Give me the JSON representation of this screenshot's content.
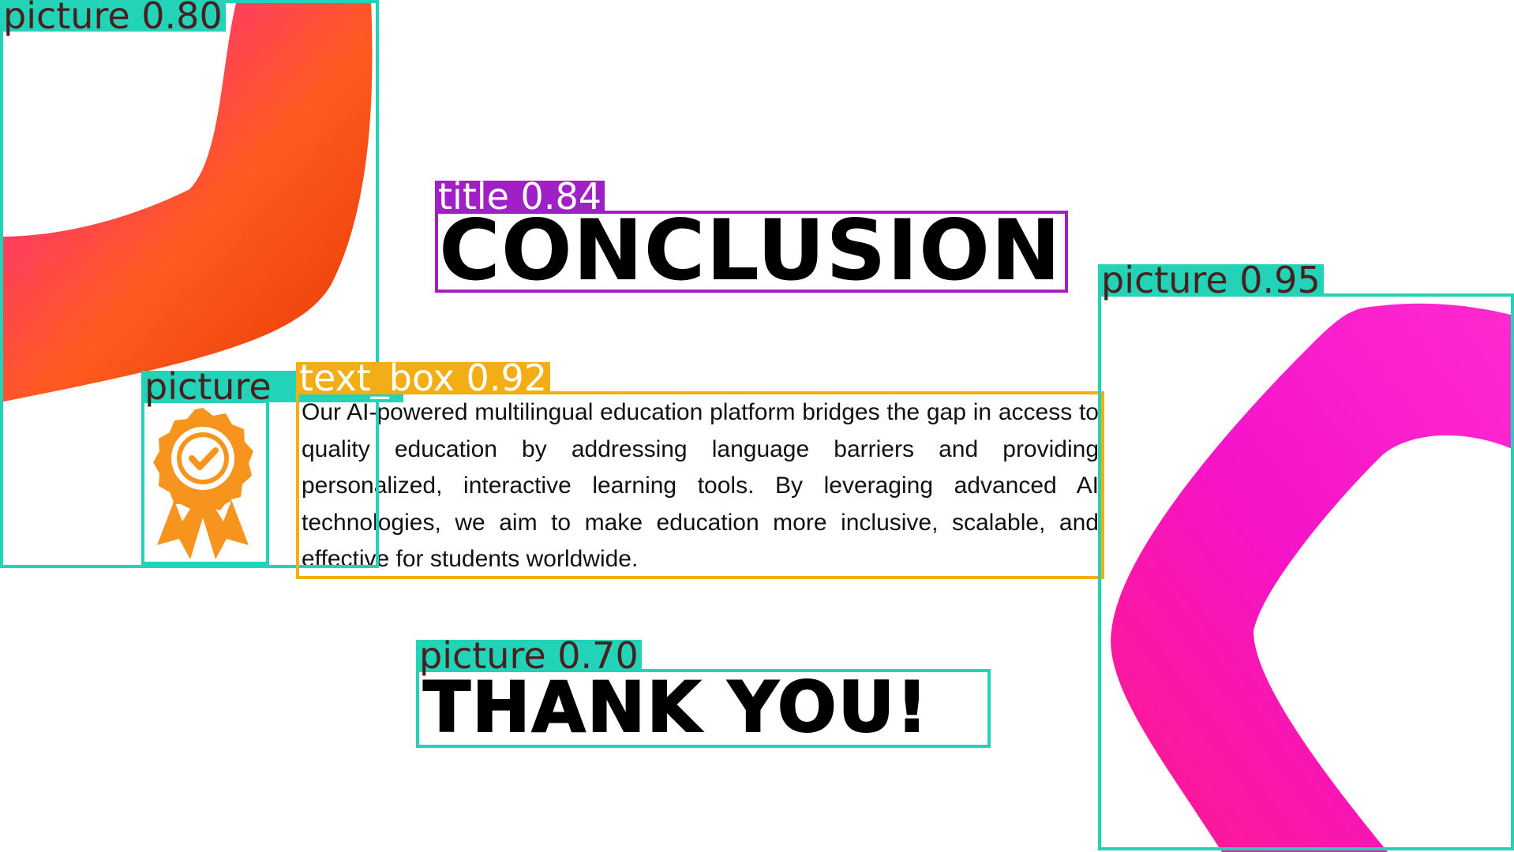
{
  "slide": {
    "title": "CONCLUSION",
    "body": "Our AI-powered multilingual education platform bridges the gap in access to quality education by addressing language barriers and providing personalized, interactive learning tools. By leveraging advanced AI technologies, we aim to make education more inclusive, scalable, and effective for students worldwide.",
    "closing": "THANK YOU!",
    "icon": "award-badge-check-icon"
  },
  "detections": {
    "picture_top_left": "picture 0.80",
    "picture_badge": "picture",
    "text_box": "text_box 0.92",
    "title": "title 0.84",
    "picture_right": "picture 0.95",
    "picture_thanks": "picture 0.70"
  },
  "colors": {
    "picture_box": "#22d3b8",
    "title_box": "#a020c8",
    "text_box": "#f2ae14",
    "ribbon_pink": "#ff1aa8",
    "ribbon_orange": "#ff6a00",
    "badge_orange": "#f7941d"
  }
}
